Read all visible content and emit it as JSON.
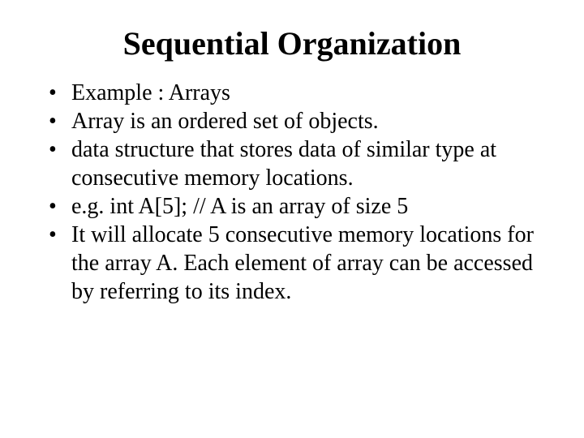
{
  "title": "Sequential Organization",
  "bullets": [
    "Example :  Arrays",
    "Array is an ordered set of objects.",
    "data structure that stores data of similar type at consecutive memory locations.",
    "e.g.  int A[5];  // A is an array of size 5",
    "It will allocate 5 consecutive memory locations for the array A. Each element of array can be accessed by referring to its index."
  ]
}
